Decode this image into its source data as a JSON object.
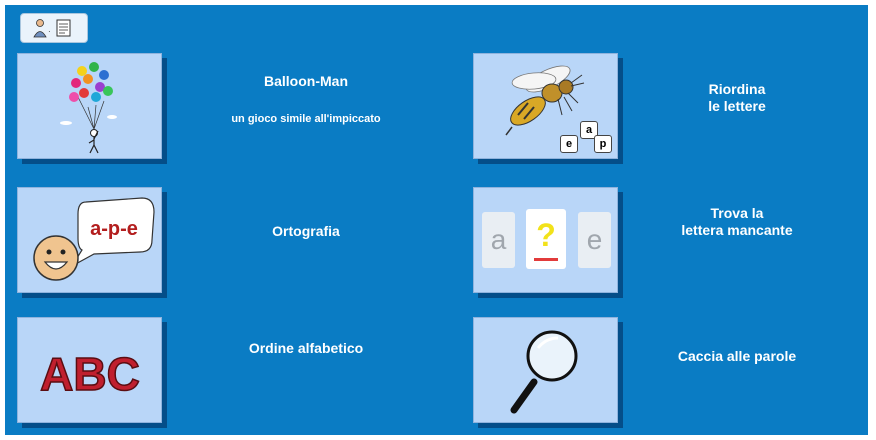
{
  "colors": {
    "background": "#0a7cc4",
    "card": "#b9d6f8",
    "label_text": "#ffffff"
  },
  "toolbar": {
    "settings_icon": "teacher-settings-icon"
  },
  "games": [
    {
      "title": "Balloon-Man",
      "subtitle": "un gioco simile all'impiccato",
      "icon": "balloons-stick-figure-icon"
    },
    {
      "title_line1": "Riordina",
      "title_line2": "le lettere",
      "icon": "wasp-letters-icon",
      "tiles": [
        "e",
        "a",
        "p"
      ]
    },
    {
      "title": "Ortografia",
      "icon": "spelling-speech-bubble-icon",
      "bubble_text": "a-p-e"
    },
    {
      "title_line1": "Trova la",
      "title_line2": "lettera mancante",
      "icon": "missing-letter-icon",
      "tiles": [
        "a",
        "?",
        "e"
      ]
    },
    {
      "title": "Ordine alfabetico",
      "icon": "abc-icon",
      "abc_text": "ABC"
    },
    {
      "title": "Caccia alle parole",
      "icon": "magnifying-glass-icon"
    }
  ]
}
